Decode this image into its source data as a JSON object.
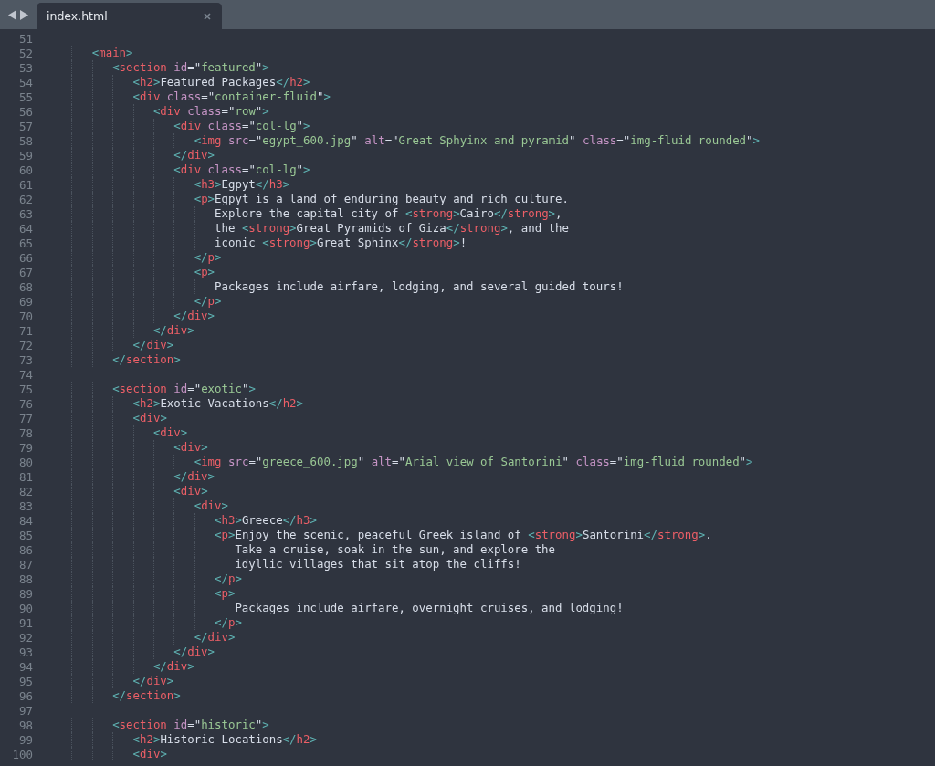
{
  "tabs": [
    {
      "label": "index.html",
      "selected": true
    }
  ],
  "lines": [
    {
      "number": "51"
    },
    {
      "number": "52",
      "text": "      <main>"
    },
    {
      "number": "53",
      "text": "         <section id=\"featured\">"
    },
    {
      "number": "54",
      "text": "            <h2>Featured Packages</h2>"
    },
    {
      "number": "55",
      "text": "            <div class=\"container-fluid\">"
    },
    {
      "number": "56",
      "text": "               <div class=\"row\">"
    },
    {
      "number": "57",
      "text": "                  <div class=\"col-lg\">"
    },
    {
      "number": "58",
      "text": "                     <img src=\"egypt_600.jpg\" alt=\"Great Sphyinx and pyramid\" class=\"img-fluid rounded\">"
    },
    {
      "number": "59",
      "text": "                  </div>"
    },
    {
      "number": "60",
      "text": "                  <div class=\"col-lg\">"
    },
    {
      "number": "61",
      "text": "                     <h3>Egpyt</h3>"
    },
    {
      "number": "62",
      "text": "                     <p>Egpyt is a land of enduring beauty and rich culture."
    },
    {
      "number": "63",
      "text": "                        Explore the capital city of <strong>Cairo</strong>,"
    },
    {
      "number": "64",
      "text": "                        the <strong>Great Pyramids of Giza</strong>, and the"
    },
    {
      "number": "65",
      "text": "                        iconic <strong>Great Sphinx</strong>!"
    },
    {
      "number": "66",
      "text": "                     </p>"
    },
    {
      "number": "67",
      "text": "                     <p>"
    },
    {
      "number": "68",
      "text": "                        Packages include airfare, lodging, and several guided tours!"
    },
    {
      "number": "69",
      "text": "                     </p>"
    },
    {
      "number": "70",
      "text": "                  </div>"
    },
    {
      "number": "71",
      "text": "               </div>"
    },
    {
      "number": "72",
      "text": "            </div>"
    },
    {
      "number": "73",
      "text": "         </section>"
    },
    {
      "number": "74"
    },
    {
      "number": "75",
      "text": "         <section id=\"exotic\">"
    },
    {
      "number": "76",
      "text": "            <h2>Exotic Vacations</h2>"
    },
    {
      "number": "77",
      "text": "            <div>"
    },
    {
      "number": "78",
      "text": "               <div>"
    },
    {
      "number": "79",
      "text": "                  <div>"
    },
    {
      "number": "80",
      "text": "                     <img src=\"greece_600.jpg\" alt=\"Arial view of Santorini\" class=\"img-fluid rounded\">"
    },
    {
      "number": "81",
      "text": "                  </div>"
    },
    {
      "number": "82",
      "text": "                  <div>"
    },
    {
      "number": "83",
      "text": "                     <div>"
    },
    {
      "number": "84",
      "text": "                        <h3>Greece</h3>"
    },
    {
      "number": "85",
      "text": "                        <p>Enjoy the scenic, peaceful Greek island of <strong>Santorini</strong>."
    },
    {
      "number": "86",
      "text": "                           Take a cruise, soak in the sun, and explore the"
    },
    {
      "number": "87",
      "text": "                           idyllic villages that sit atop the cliffs!"
    },
    {
      "number": "88",
      "text": "                        </p>"
    },
    {
      "number": "89",
      "text": "                        <p>"
    },
    {
      "number": "90",
      "text": "                           Packages include airfare, overnight cruises, and lodging!"
    },
    {
      "number": "91",
      "text": "                        </p>"
    },
    {
      "number": "92",
      "text": "                     </div>"
    },
    {
      "number": "93",
      "text": "                  </div>"
    },
    {
      "number": "94",
      "text": "               </div>"
    },
    {
      "number": "95",
      "text": "            </div>"
    },
    {
      "number": "96",
      "text": "         </section>"
    },
    {
      "number": "97"
    },
    {
      "number": "98",
      "text": "         <section id=\"historic\">"
    },
    {
      "number": "99",
      "text": "            <h2>Historic Locations</h2>"
    },
    {
      "number": "100",
      "text": "            <div>"
    }
  ]
}
